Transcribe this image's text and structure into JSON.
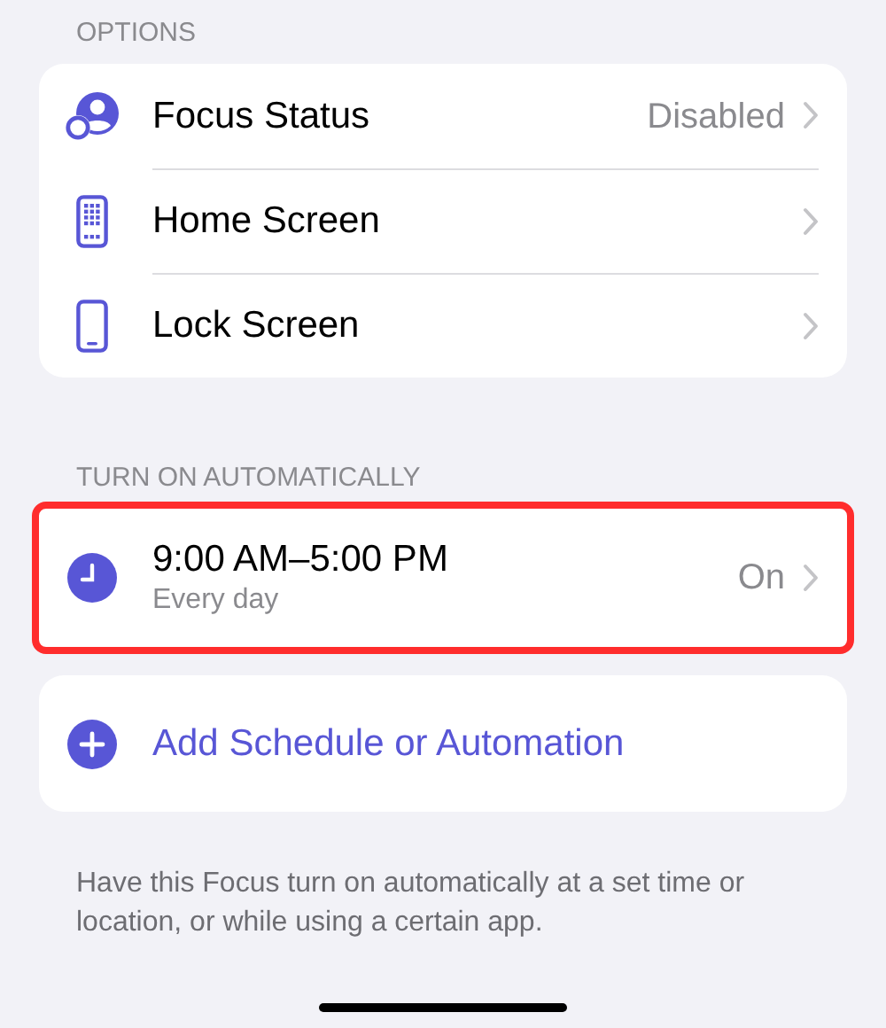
{
  "options_section": {
    "header": "OPTIONS",
    "rows": [
      {
        "label": "Focus Status",
        "value": "Disabled"
      },
      {
        "label": "Home Screen"
      },
      {
        "label": "Lock Screen"
      }
    ]
  },
  "automation_section": {
    "header": "TURN ON AUTOMATICALLY",
    "schedules": [
      {
        "title": "9:00 AM–5:00 PM",
        "subtitle": "Every day",
        "status": "On",
        "highlighted": true
      }
    ],
    "add_button": "Add Schedule or Automation",
    "footer": "Have this Focus turn on automatically at a set time or location, or while using a certain app."
  }
}
